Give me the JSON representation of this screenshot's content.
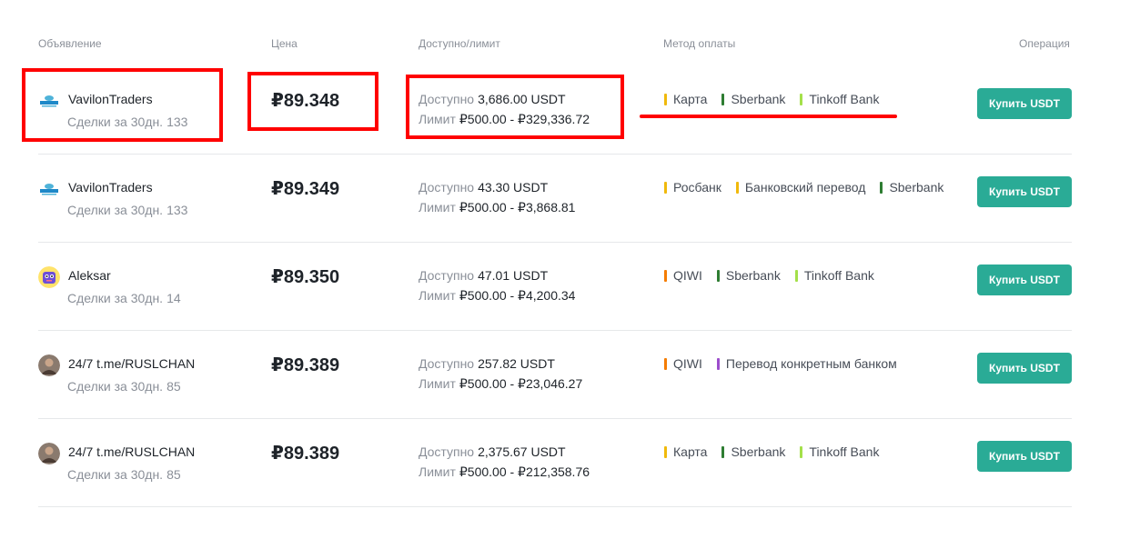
{
  "headers": {
    "ad": "Объявление",
    "price": "Цена",
    "available_limit": "Доступно/лимит",
    "payment_method": "Метод оплаты",
    "operation": "Операция"
  },
  "labels": {
    "available": "Доступно",
    "limit": "Лимит",
    "deals": "Сделки за 30дн."
  },
  "rows": [
    {
      "name": "VavilonTraders",
      "deals": "133",
      "avatar": "vavilon-logo",
      "price": "₽89.348",
      "available": "3,686.00 USDT",
      "limit": "₽500.00 - ₽329,336.72",
      "methods": [
        {
          "name": "Карта",
          "color": "#f0b90b"
        },
        {
          "name": "Sberbank",
          "color": "#2e7d32"
        },
        {
          "name": "Tinkoff Bank",
          "color": "#a4e04a"
        }
      ],
      "button": "Купить USDT"
    },
    {
      "name": "VavilonTraders",
      "deals": "133",
      "avatar": "vavilon-logo",
      "price": "₽89.349",
      "available": "43.30 USDT",
      "limit": "₽500.00 - ₽3,868.81",
      "methods": [
        {
          "name": "Росбанк",
          "color": "#f0b90b"
        },
        {
          "name": "Банковский перевод",
          "color": "#f0b90b"
        },
        {
          "name": "Sberbank",
          "color": "#2e7d32"
        }
      ],
      "button": "Купить USDT"
    },
    {
      "name": "Aleksar",
      "deals": "14",
      "avatar": "cartoon-avatar",
      "price": "₽89.350",
      "available": "47.01 USDT",
      "limit": "₽500.00 - ₽4,200.34",
      "methods": [
        {
          "name": "QIWI",
          "color": "#f57c00"
        },
        {
          "name": "Sberbank",
          "color": "#2e7d32"
        },
        {
          "name": "Tinkoff Bank",
          "color": "#a4e04a"
        }
      ],
      "button": "Купить USDT"
    },
    {
      "name": "24/7 t.me/RUSLCHAN",
      "deals": "85",
      "avatar": "photo-avatar",
      "price": "₽89.389",
      "available": "257.82 USDT",
      "limit": "₽500.00 - ₽23,046.27",
      "methods": [
        {
          "name": "QIWI",
          "color": "#f57c00"
        },
        {
          "name": "Перевод конкретным банком",
          "color": "#9c4dcc"
        }
      ],
      "button": "Купить USDT"
    },
    {
      "name": "24/7 t.me/RUSLCHAN",
      "deals": "85",
      "avatar": "photo-avatar",
      "price": "₽89.389",
      "available": "2,375.67 USDT",
      "limit": "₽500.00 - ₽212,358.76",
      "methods": [
        {
          "name": "Карта",
          "color": "#f0b90b"
        },
        {
          "name": "Sberbank",
          "color": "#2e7d32"
        },
        {
          "name": "Tinkoff Bank",
          "color": "#a4e04a"
        }
      ],
      "button": "Купить USDT"
    }
  ],
  "colors": {
    "accent": "#2aab96",
    "annotation": "#ff0000"
  }
}
